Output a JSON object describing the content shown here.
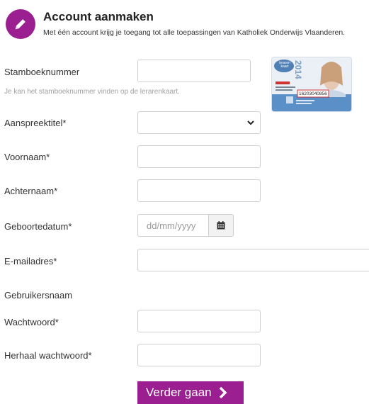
{
  "header": {
    "title": "Account aanmaken",
    "subtitle": "Met één account krijg je toegang tot alle toepassingen van Katholiek Onderwijs Vlaanderen.",
    "icon": "pencil-icon"
  },
  "form": {
    "stamboeknummer_label": "Stamboeknummer",
    "stamboeknummer_hint": "Je kan het stamboeknummer vinden op de lerarenkaart.",
    "aanspreektitel_label": "Aanspreektitel*",
    "voornaam_label": "Voornaam*",
    "achternaam_label": "Achternaam*",
    "geboortedatum_label": "Geboortedatum*",
    "geboortedatum_placeholder": "dd/mm/yyyy",
    "email_label": "E-mailadres*",
    "gebruikersnaam_label": "Gebruikersnaam",
    "wachtwoord_label": "Wachtwoord*",
    "herhaal_label": "Herhaal wachtwoord*",
    "submit_label": "Verder gaan"
  },
  "card": {
    "year": "2014",
    "number": "16203040856",
    "brand": "leraren kaart"
  },
  "colors": {
    "accent": "#9c1f91"
  }
}
